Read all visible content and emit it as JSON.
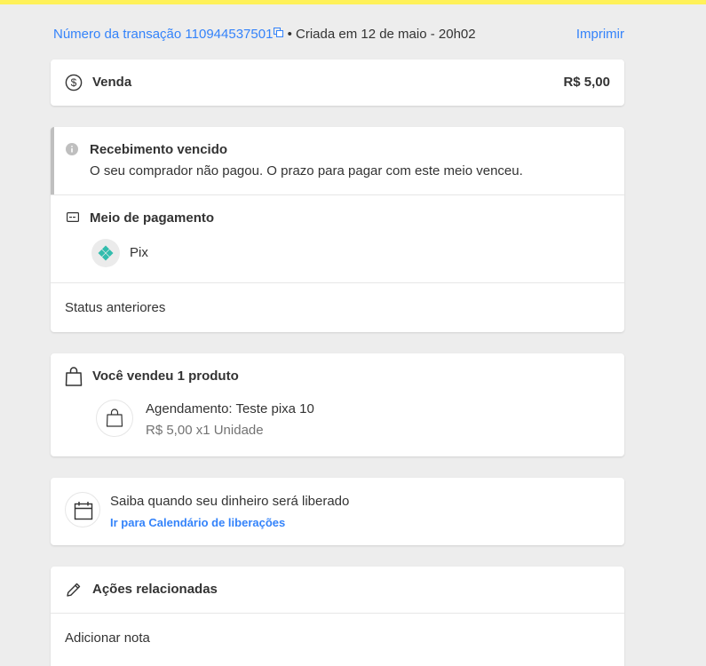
{
  "header": {
    "transaction_label": "Número da transação 110944537501",
    "created": "• Criada em 12 de maio - 20h02",
    "print_label": "Imprimir"
  },
  "venda": {
    "title": "Venda",
    "value": "R$ 5,00"
  },
  "status": {
    "notice_title": "Recebimento vencido",
    "notice_text": "O seu comprador não pagou. O prazo para pagar com este meio venceu.",
    "payment_title": "Meio de pagamento",
    "payment_method": "Pix",
    "previous_status_label": "Status anteriores"
  },
  "produto": {
    "title": "Você vendeu 1 produto",
    "item_name": "Agendamento: Teste pixa 10",
    "item_price": "R$ 5,00 x1 Unidade"
  },
  "calendario": {
    "title": "Saiba quando seu dinheiro será liberado",
    "link": "Ir para Calendário de liberações"
  },
  "acoes": {
    "title": "Ações relacionadas",
    "add_note": "Adicionar nota"
  },
  "colors": {
    "brand_yellow": "#fff159",
    "link_blue": "#3483fa",
    "pix_teal": "#32bcad",
    "background": "#ededed"
  },
  "icons": [
    "copy-icon",
    "dollar-circle-icon",
    "info-icon",
    "credit-card-icon",
    "pix-icon",
    "shopping-bag-icon",
    "calendar-icon",
    "pencil-icon"
  ]
}
